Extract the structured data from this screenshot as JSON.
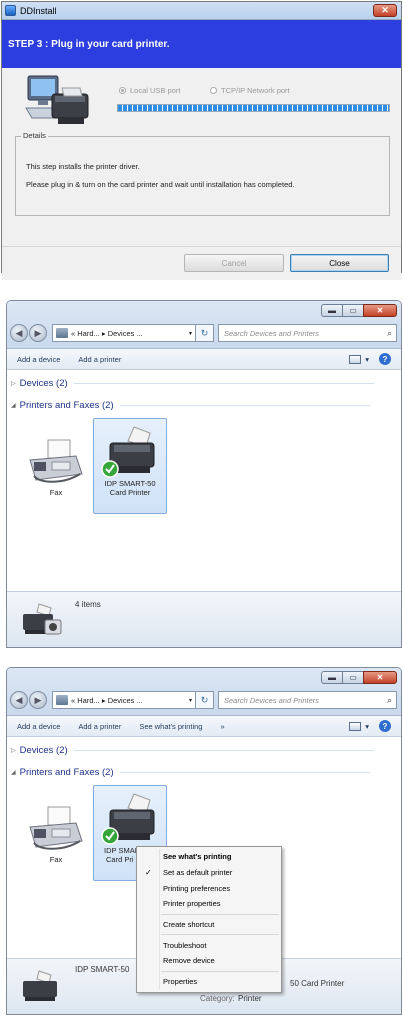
{
  "installer": {
    "title": "DDInstall",
    "close_glyph": "✕",
    "step_text": "STEP 3 : Plug in your card printer.",
    "radio_usb": "Local USB port",
    "radio_network": "TCP/IP Network port",
    "progress_fraction": 1.0,
    "details_label": "Details",
    "details_line1": "This step installs the printer driver.",
    "details_line2": "Please plug in & turn on the card printer and wait until installation has completed.",
    "cancel_label": "Cancel",
    "close_label": "Close"
  },
  "explorer1": {
    "min_glyph": "▬",
    "max_glyph": "▭",
    "close_glyph": "✕",
    "back_glyph": "◀",
    "fwd_glyph": "▶",
    "address": "« Hard... ▸ Devices ...",
    "address_dd": "▾",
    "refresh_glyph": "↻",
    "search_placeholder": "Search Devices and Printers",
    "search_icon": "⌕",
    "commands": [
      "Add a device",
      "Add a printer"
    ],
    "help_glyph": "?",
    "view_dd": "▾",
    "group_devices": "Devices (2)",
    "group_devices_tri": "▷",
    "group_printers": "Printers and Faxes (2)",
    "group_printers_tri": "◢",
    "device_fax": "Fax",
    "device_printer_line1": "IDP SMART-50",
    "device_printer_line2": "Card Printer",
    "items_count": "4 items"
  },
  "explorer2": {
    "commands": [
      "Add a device",
      "Add a printer",
      "See what's printing",
      "»"
    ],
    "group_devices": "Devices (2)",
    "group_printers": "Printers and Faxes (2)",
    "device_fax": "Fax",
    "device_printer_line1": "IDP SMAR",
    "device_printer_line2": "Card Pri",
    "details_name": "IDP SMART-50",
    "details_model_tail": "50 Card Printer",
    "details_category_label": "Category:",
    "details_category_value": "Printer"
  },
  "context_menu": {
    "items": [
      {
        "label": "See what's printing",
        "bold": true
      },
      {
        "label": "Set as default printer",
        "checked": true
      },
      {
        "label": "Printing preferences"
      },
      {
        "label": "Printer properties"
      },
      {
        "label": "Create shortcut"
      },
      {
        "label": "Troubleshoot"
      },
      {
        "label": "Remove device"
      },
      {
        "label": "Properties"
      }
    ],
    "check_glyph": "✓"
  }
}
